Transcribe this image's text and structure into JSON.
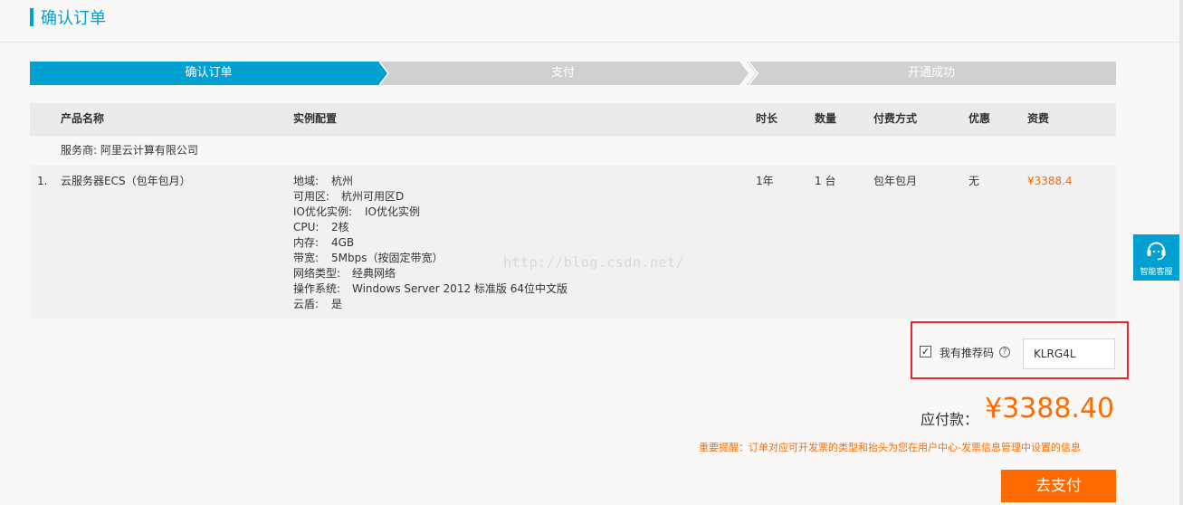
{
  "page": {
    "title": "确认订单"
  },
  "steps": [
    "确认订单",
    "支付",
    "开通成功"
  ],
  "table": {
    "headers": {
      "product": "产品名称",
      "config": "实例配置",
      "duration": "时长",
      "quantity": "数量",
      "payment": "付费方式",
      "discount": "优惠",
      "fee": "资费"
    },
    "provider": "服务商: 阿里云计算有限公司",
    "rows": [
      {
        "index": "1.",
        "product": "云服务器ECS（包年包月）",
        "config": [
          {
            "key": "地域:",
            "value": "杭州"
          },
          {
            "key": "可用区:",
            "value": "杭州可用区D"
          },
          {
            "key": "IO优化实例:",
            "value": "IO优化实例"
          },
          {
            "key": "CPU:",
            "value": "2核"
          },
          {
            "key": "内存:",
            "value": "4GB"
          },
          {
            "key": "带宽:",
            "value": "5Mbps（按固定带宽）"
          },
          {
            "key": "网络类型:",
            "value": "经典网络"
          },
          {
            "key": "操作系统:",
            "value": "Windows Server 2012 标准版 64位中文版"
          },
          {
            "key": "云盾:",
            "value": "是"
          }
        ],
        "duration": "1年",
        "quantity": "1 台",
        "payment": "包年包月",
        "discount": "无",
        "fee": "¥3388.4"
      }
    ]
  },
  "watermark": "http://blog.csdn.net/",
  "promo": {
    "checked": true,
    "label": "我有推荐码",
    "code": "KLRG4L"
  },
  "summary": {
    "label": "应付款：",
    "amount": "¥3388.40",
    "notice": "重要提醒：订单对应可开发票的类型和抬头为您在用户中心-发票信息管理中设置的信息",
    "pay_button": "去支付"
  },
  "service_widget": {
    "label": "智能客服",
    "icon": "headset-icon"
  },
  "colors": {
    "accent": "#00a0d2",
    "price": "#ff6a00",
    "highlight_box": "#e0282e"
  }
}
